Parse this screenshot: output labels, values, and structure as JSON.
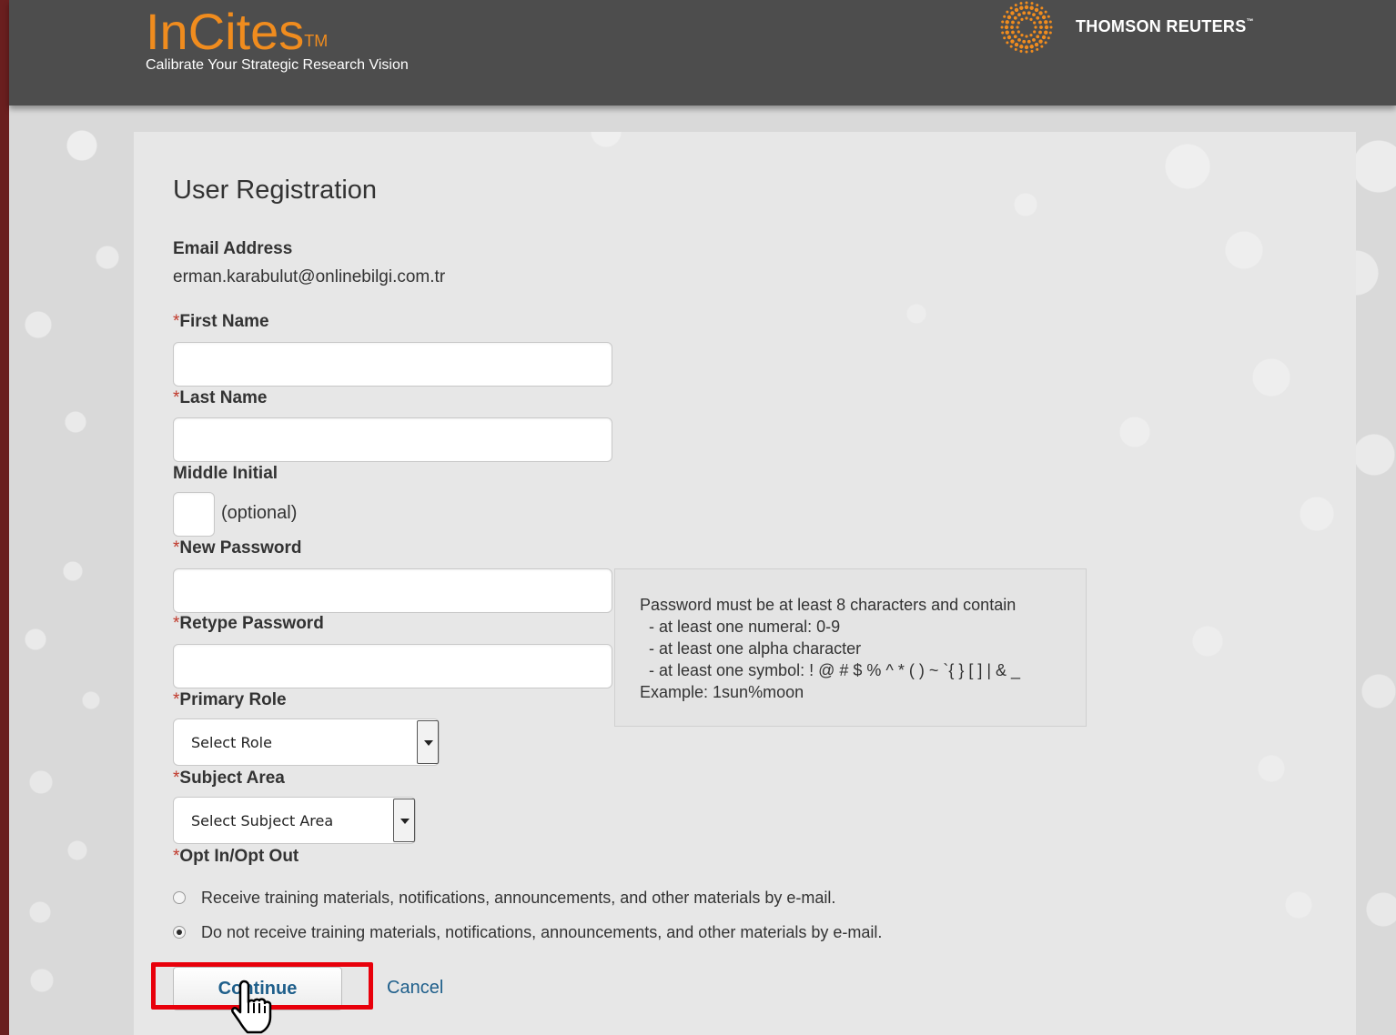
{
  "header": {
    "app_name": "InCites",
    "app_trademark": "TM",
    "tagline": "Calibrate Your Strategic Research Vision",
    "company_name": "THOMSON REUTERS",
    "company_trademark": "™"
  },
  "form": {
    "title": "User Registration",
    "email": {
      "label": "Email Address",
      "value": "erman.karabulut@onlinebilgi.com.tr"
    },
    "first_name": {
      "required_mark": "*",
      "label": "First Name",
      "value": ""
    },
    "last_name": {
      "required_mark": "*",
      "label": "Last Name",
      "value": ""
    },
    "middle_initial": {
      "label": "Middle Initial",
      "value": "",
      "hint": "(optional)"
    },
    "new_password": {
      "required_mark": "*",
      "label": "New Password",
      "value": ""
    },
    "retype_password": {
      "required_mark": "*",
      "label": "Retype Password",
      "value": ""
    },
    "password_rules": [
      "Password must be at least 8 characters and contain",
      "  - at least one numeral: 0-9",
      "  - at least one alpha character",
      "  - at least one symbol: ! @ # $ % ^ * ( ) ~ `{ } [ ] | & _",
      "Example: 1sun%moon"
    ],
    "primary_role": {
      "required_mark": "*",
      "label": "Primary Role",
      "selected": "Select Role"
    },
    "subject_area": {
      "required_mark": "*",
      "label": "Subject Area",
      "selected": "Select Subject Area"
    },
    "opt": {
      "required_mark": "*",
      "label": "Opt In/Opt Out",
      "options": [
        {
          "text": "Receive training materials, notifications, announcements, and other materials by e-mail.",
          "checked": false
        },
        {
          "text": "Do not receive training materials, notifications, announcements, and other materials by e-mail.",
          "checked": true
        }
      ]
    },
    "continue_label": "Continue",
    "cancel_label": "Cancel"
  },
  "colors": {
    "brand_orange": "#f08c1e",
    "header_bg": "#4d4d4d",
    "link_blue": "#1f5f8b",
    "highlight_red": "#e8000b"
  }
}
